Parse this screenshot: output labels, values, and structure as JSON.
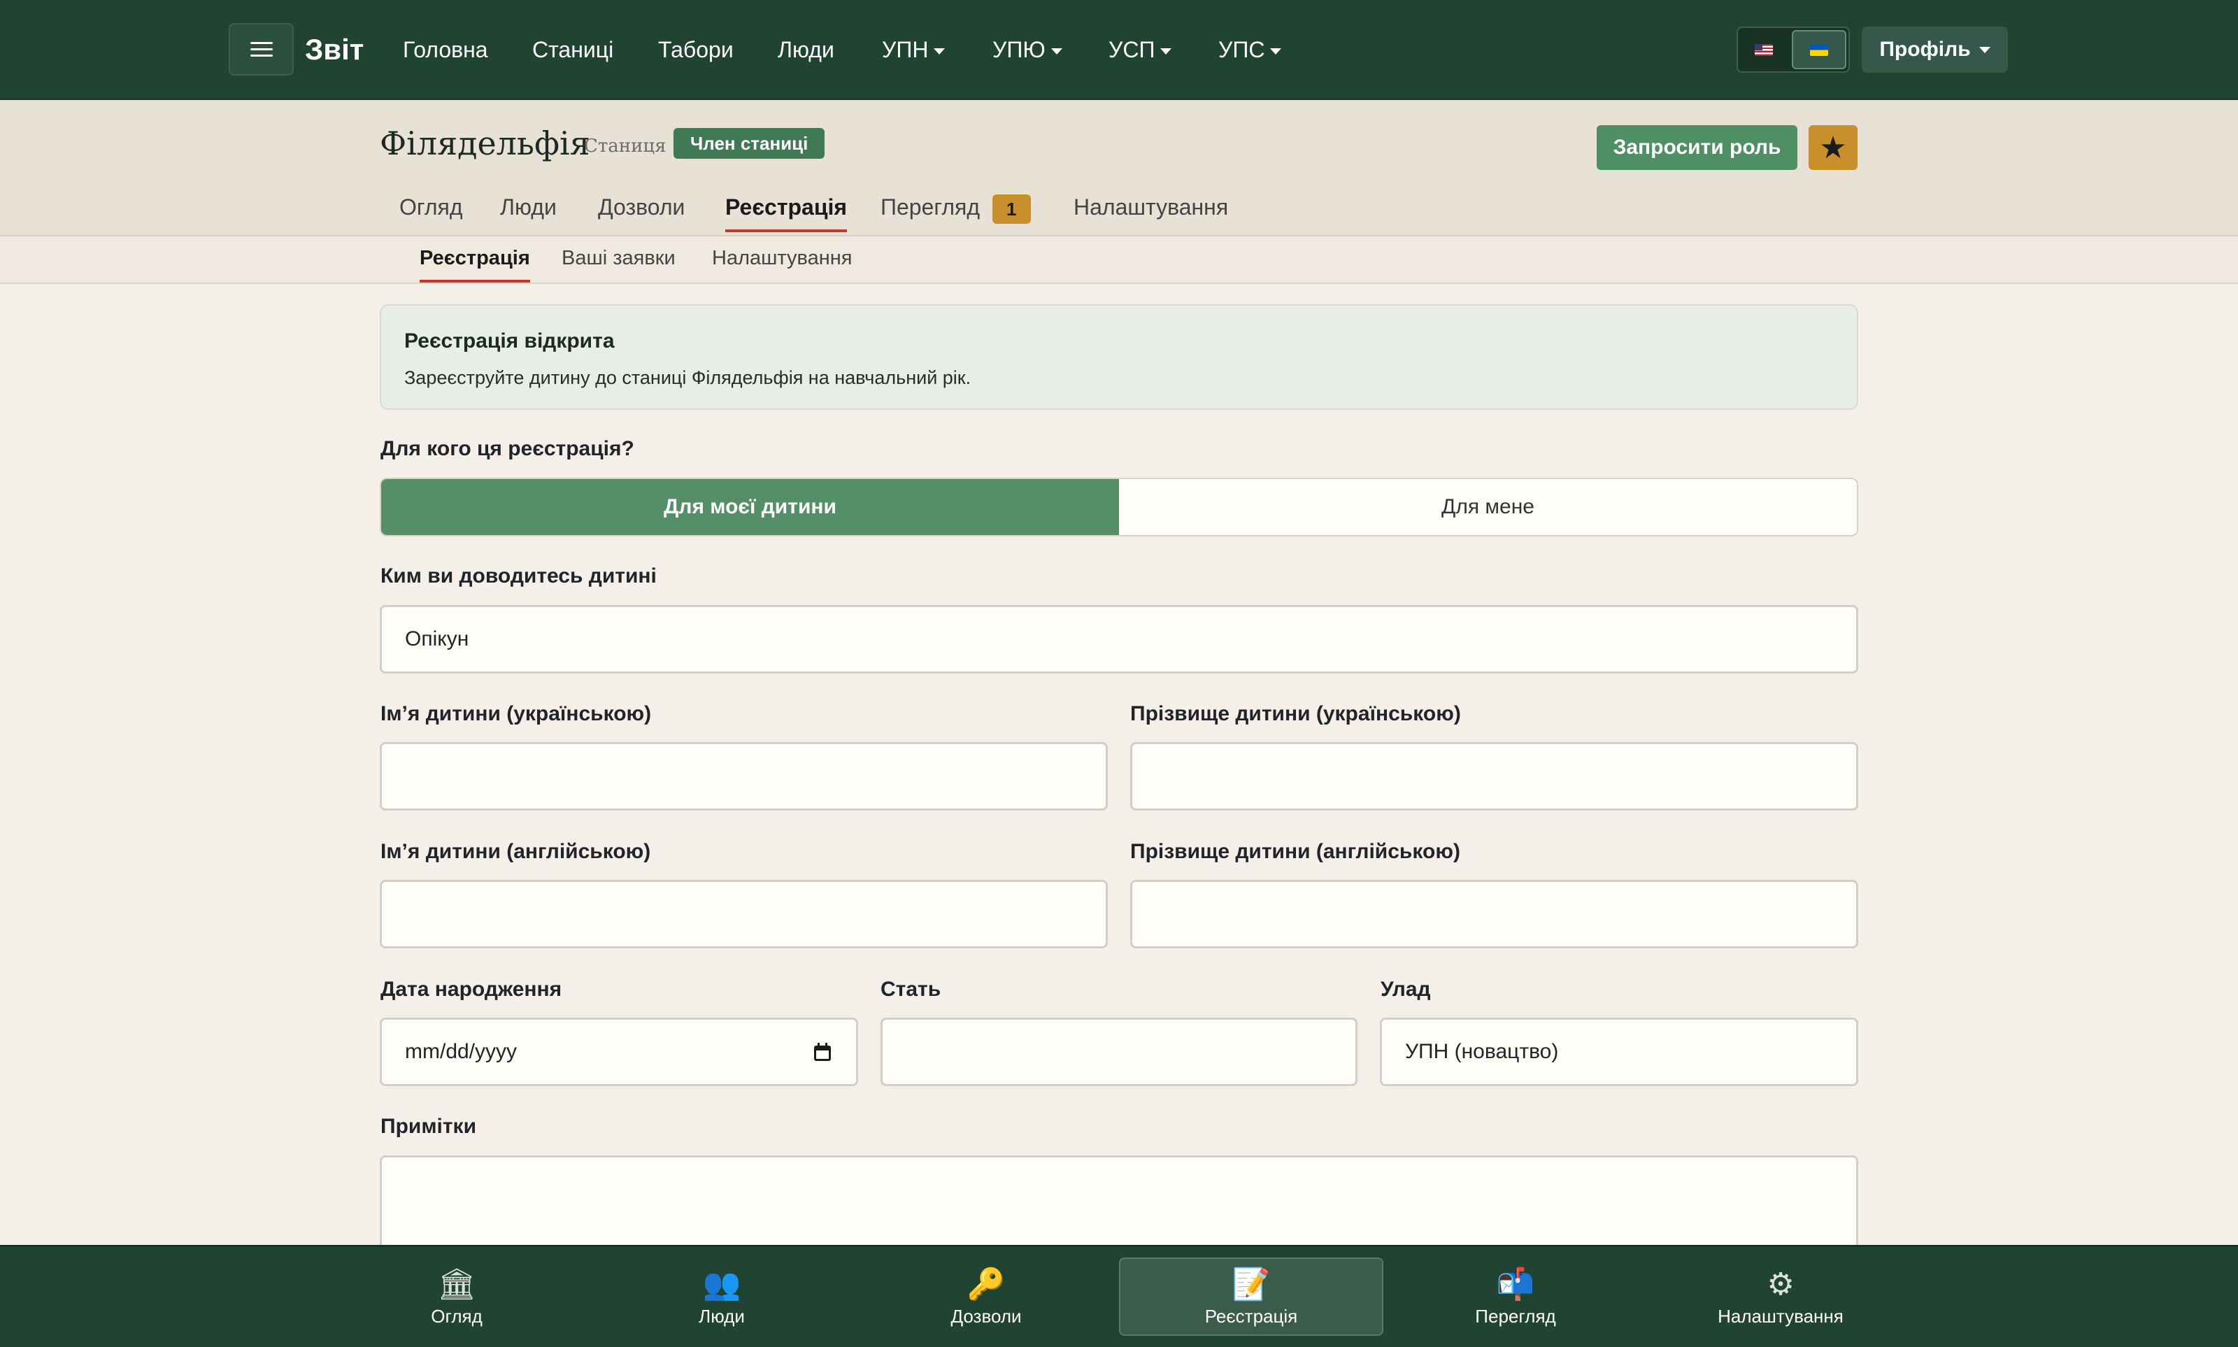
{
  "topbar": {
    "brand": "Звіт",
    "nav": [
      {
        "label": "Головна"
      },
      {
        "label": "Станиці"
      },
      {
        "label": "Табори"
      },
      {
        "label": "Люди"
      },
      {
        "label": "УПН"
      },
      {
        "label": "УПЮ"
      },
      {
        "label": "УСП"
      },
      {
        "label": "УПС"
      }
    ],
    "languages": [
      "en-flag",
      "uk-flag"
    ],
    "active_language": "uk",
    "profile_label": "Профіль"
  },
  "header": {
    "title": "Філядельфія",
    "subtitle": "Станиця",
    "badge": "Член станиці",
    "request_role_label": "Запросити роль",
    "star_icon": "★",
    "tabs": [
      {
        "label": "Огляд"
      },
      {
        "label": "Люди"
      },
      {
        "label": "Дозволи"
      },
      {
        "label": "Реєстрація"
      },
      {
        "label": "Перегляд",
        "count": "1"
      },
      {
        "label": "Налаштування"
      }
    ],
    "active_tab": "Реєстрація"
  },
  "subtabs": {
    "items": [
      {
        "label": "Реєстрація"
      },
      {
        "label": "Ваші заявки"
      },
      {
        "label": "Налаштування"
      }
    ],
    "active": "Реєстрація"
  },
  "info": {
    "title": "Реєстрація відкрита",
    "text": "Зареєструйте дитину до станиці Філядельфія на навчальний рік."
  },
  "form": {
    "who_label": "Для кого ця реєстрація?",
    "who_options": [
      {
        "label": "Для моєї дитини"
      },
      {
        "label": "Для мене"
      }
    ],
    "who_selected": "Для моєї дитини",
    "relation_label": "Ким ви доводитесь дитині",
    "relation_value": "Опікун",
    "first_name_uk_label": "Ім’я дитини (українською)",
    "first_name_uk_value": "",
    "last_name_uk_label": "Прізвище дитини (українською)",
    "last_name_uk_value": "",
    "first_name_en_label": "Ім’я дитини (англійською)",
    "first_name_en_value": "",
    "last_name_en_label": "Прізвище дитини (англійською)",
    "last_name_en_value": "",
    "dob_label": "Дата народження",
    "dob_placeholder": "mm/dd/yyyy",
    "sex_label": "Стать",
    "sex_value": "",
    "branch_label": "Улад",
    "branch_value": "УПН (новацтво)",
    "notes_label": "Примітки",
    "notes_value": ""
  },
  "bottom_nav": {
    "items": [
      {
        "label": "Огляд",
        "icon": "🏛"
      },
      {
        "label": "Люди",
        "icon": "👥"
      },
      {
        "label": "Дозволи",
        "icon": "🔑"
      },
      {
        "label": "Реєстрація",
        "icon": "📝"
      },
      {
        "label": "Перегляд",
        "icon": "📬"
      },
      {
        "label": "Налаштування",
        "icon": "⚙"
      }
    ],
    "active": "Реєстрація"
  },
  "colors": {
    "navbar": "#214332",
    "accent_green": "#558f68",
    "badge_green": "#3f7a55",
    "warning": "#c98f2d",
    "active_underline": "#c0392b"
  }
}
